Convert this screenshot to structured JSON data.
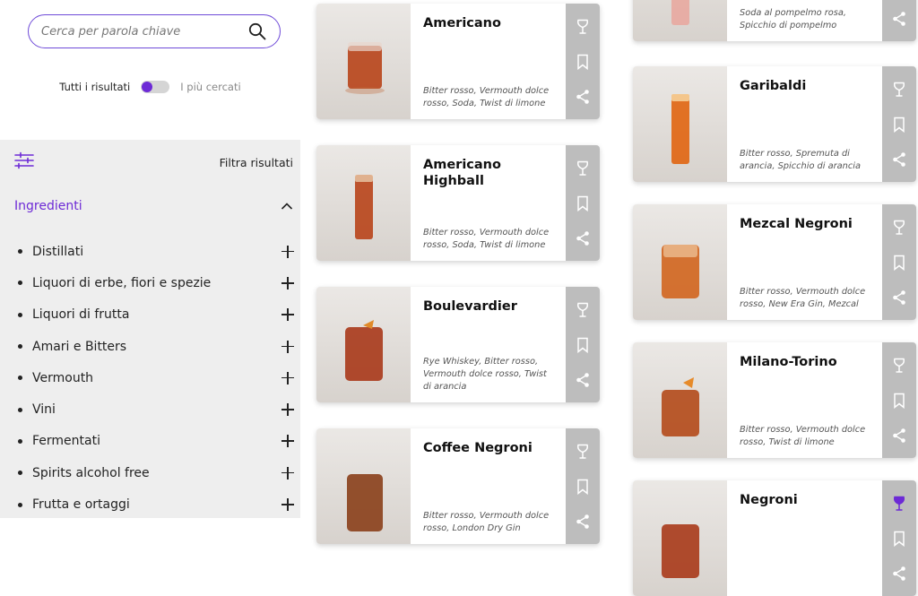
{
  "search": {
    "placeholder": "Cerca per parola chiave",
    "value": ""
  },
  "toggle": {
    "left_label": "Tutti i risultati",
    "right_label": "I più cercati"
  },
  "filters": {
    "header_label": "Filtra risultati",
    "section_title": "Ingredienti",
    "items": [
      "Distillati",
      "Liquori di erbe, fiori e spezie",
      "Liquori di frutta",
      "Amari e Bitters",
      "Vermouth",
      "Vini",
      "Fermentati",
      "Spirits alcohol free",
      "Frutta e ortaggi"
    ]
  },
  "colors": {
    "accent": "#6d2ad6",
    "action_bg": "#bdbdbd",
    "filter_bg": "#eeeeee"
  },
  "cards": [
    {
      "name": "Americano",
      "ingredients": "Bitter rosso, Vermouth dolce rosso, Soda, Twist di limone",
      "favorite": false
    },
    {
      "name": "Americano Highball",
      "ingredients": "Bitter rosso, Vermouth dolce rosso, Soda, Twist di limone",
      "favorite": false
    },
    {
      "name": "Boulevardier",
      "ingredients": "Rye Whiskey, Bitter rosso, Vermouth dolce rosso, Twist di arancia",
      "favorite": false
    },
    {
      "name": "Coffee Negroni",
      "ingredients": "Bitter rosso, Vermouth dolce rosso, London Dry Gin",
      "favorite": false
    },
    {
      "name": "",
      "ingredients": "Soda al pompelmo rosa, Spicchio di pompelmo",
      "favorite": false
    },
    {
      "name": "Garibaldi",
      "ingredients": "Bitter rosso, Spremuta di arancia, Spicchio di arancia",
      "favorite": false
    },
    {
      "name": "Mezcal Negroni",
      "ingredients": "Bitter rosso, Vermouth dolce rosso, New Era Gin, Mezcal",
      "favorite": false
    },
    {
      "name": "Milano-Torino",
      "ingredients": "Bitter rosso, Vermouth dolce rosso, Twist di limone",
      "favorite": false
    },
    {
      "name": "Negroni",
      "ingredients": "",
      "favorite": true
    }
  ]
}
